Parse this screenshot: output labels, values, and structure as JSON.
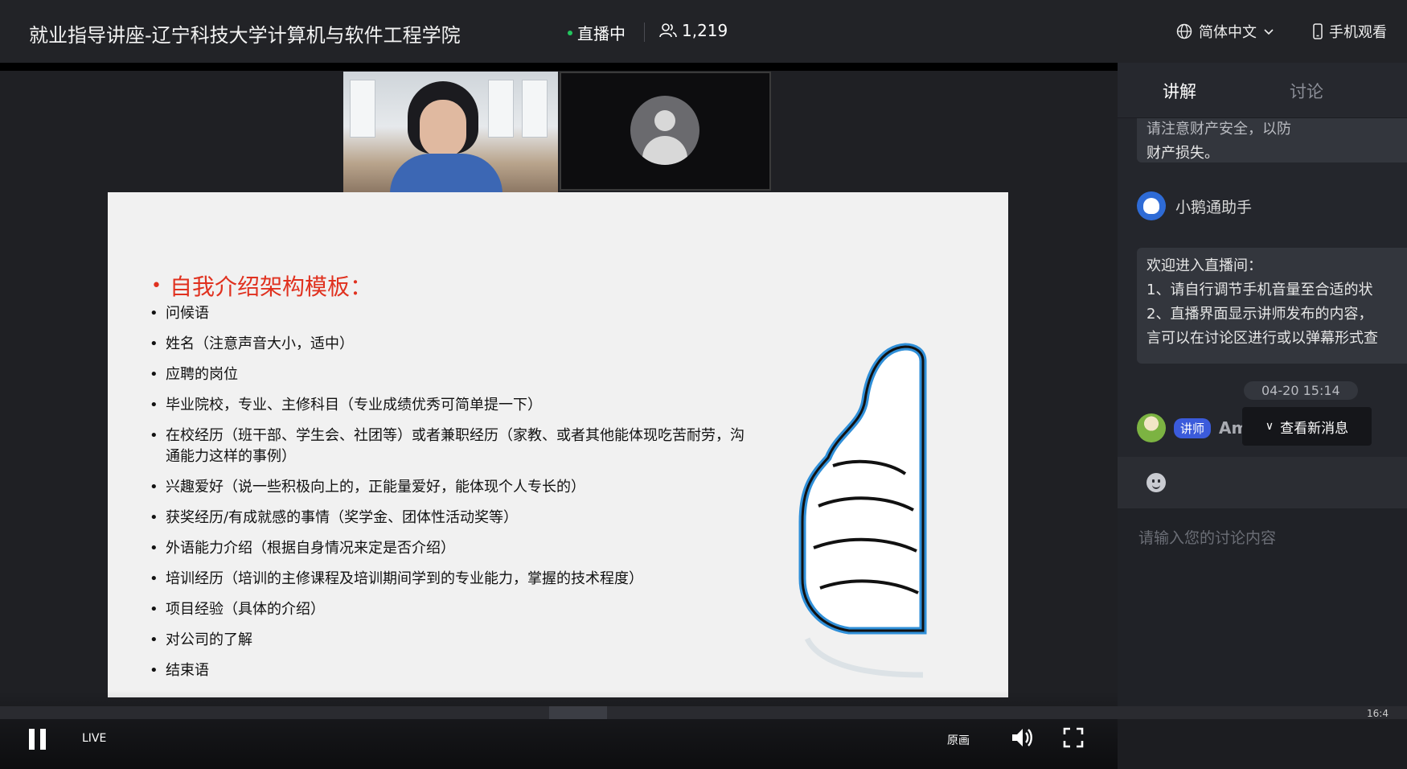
{
  "header": {
    "title": "就业指导讲座-辽宁科技大学计算机与软件工程学院",
    "live_status": "直播中",
    "viewer_count": "1,219",
    "language": "简体中文",
    "mobile_watch": "手机观看"
  },
  "slide": {
    "heading": "自我介绍架构模板：",
    "items": [
      "问候语",
      "姓名（注意声音大小，适中）",
      "应聘的岗位",
      "毕业院校，专业、主修科目（专业成绩优秀可简单提一下）",
      "在校经历（班干部、学生会、社团等）或者兼职经历（家教、或者其他能体现吃苦耐劳，沟通能力这样的事例）",
      "兴趣爱好（说一些积极向上的，正能量爱好，能体现个人专长的）",
      "获奖经历/有成就感的事情（奖学金、团体性活动奖等）",
      "外语能力介绍（根据自身情况来定是否介绍）",
      "培训经历（培训的主修课程及培训期间学到的专业能力，掌握的技术程度）",
      "项目经验（具体的介绍）",
      "对公司的了解",
      "结束语"
    ]
  },
  "controls": {
    "live_label": "LIVE",
    "quality_label": "原画"
  },
  "sidebar": {
    "tabs": [
      "讲解",
      "讨论"
    ],
    "msg1_clip": "请注意财产安全，以防",
    "msg1_line2": "财产损失。",
    "assistant_name": "小鹅通助手",
    "welcome_lines": [
      "欢迎进入直播间：",
      "1、请自行调节手机音量至合适的状",
      "2、直播界面显示讲师发布的内容，",
      "言可以在讨论区进行或以弹幕形式查"
    ],
    "time": "04-20 15:14",
    "speaker_tag": "讲师",
    "speaker_name": "Amanda",
    "new_messages": "查看新消息",
    "input_placeholder": "请输入您的讨论内容"
  },
  "taskbar": {
    "clock": "16:4"
  },
  "colors": {
    "slide_heading": "#e0311f",
    "live_dot": "#22c55e",
    "speaker_tag_bg": "#3b5bdb"
  }
}
